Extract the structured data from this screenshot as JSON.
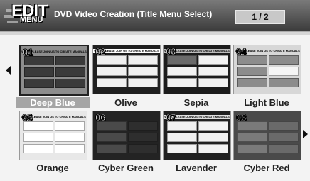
{
  "header": {
    "logo_main": "EDIT",
    "logo_sub": "MENU",
    "title": "DVD Video Creation (Title Menu Select)",
    "page_indicator": "1 / 2"
  },
  "thumb_banner": "WATE, PLEASE JOIN US TO CREATE MANUALS",
  "themes": [
    {
      "num": "01",
      "label": "Deep Blue",
      "selected": true
    },
    {
      "num": "02",
      "label": "Olive",
      "selected": false
    },
    {
      "num": "03",
      "label": "Sepia",
      "selected": false
    },
    {
      "num": "04",
      "label": "Light Blue",
      "selected": false
    },
    {
      "num": "05",
      "label": "Orange",
      "selected": false
    },
    {
      "num": "06",
      "label": "Cyber Green",
      "selected": false
    },
    {
      "num": "07",
      "label": "Lavender",
      "selected": false
    },
    {
      "num": "08",
      "label": "Cyber Red",
      "selected": false
    }
  ],
  "icons": [
    "arrow-left-icon",
    "arrow-right-icon"
  ]
}
